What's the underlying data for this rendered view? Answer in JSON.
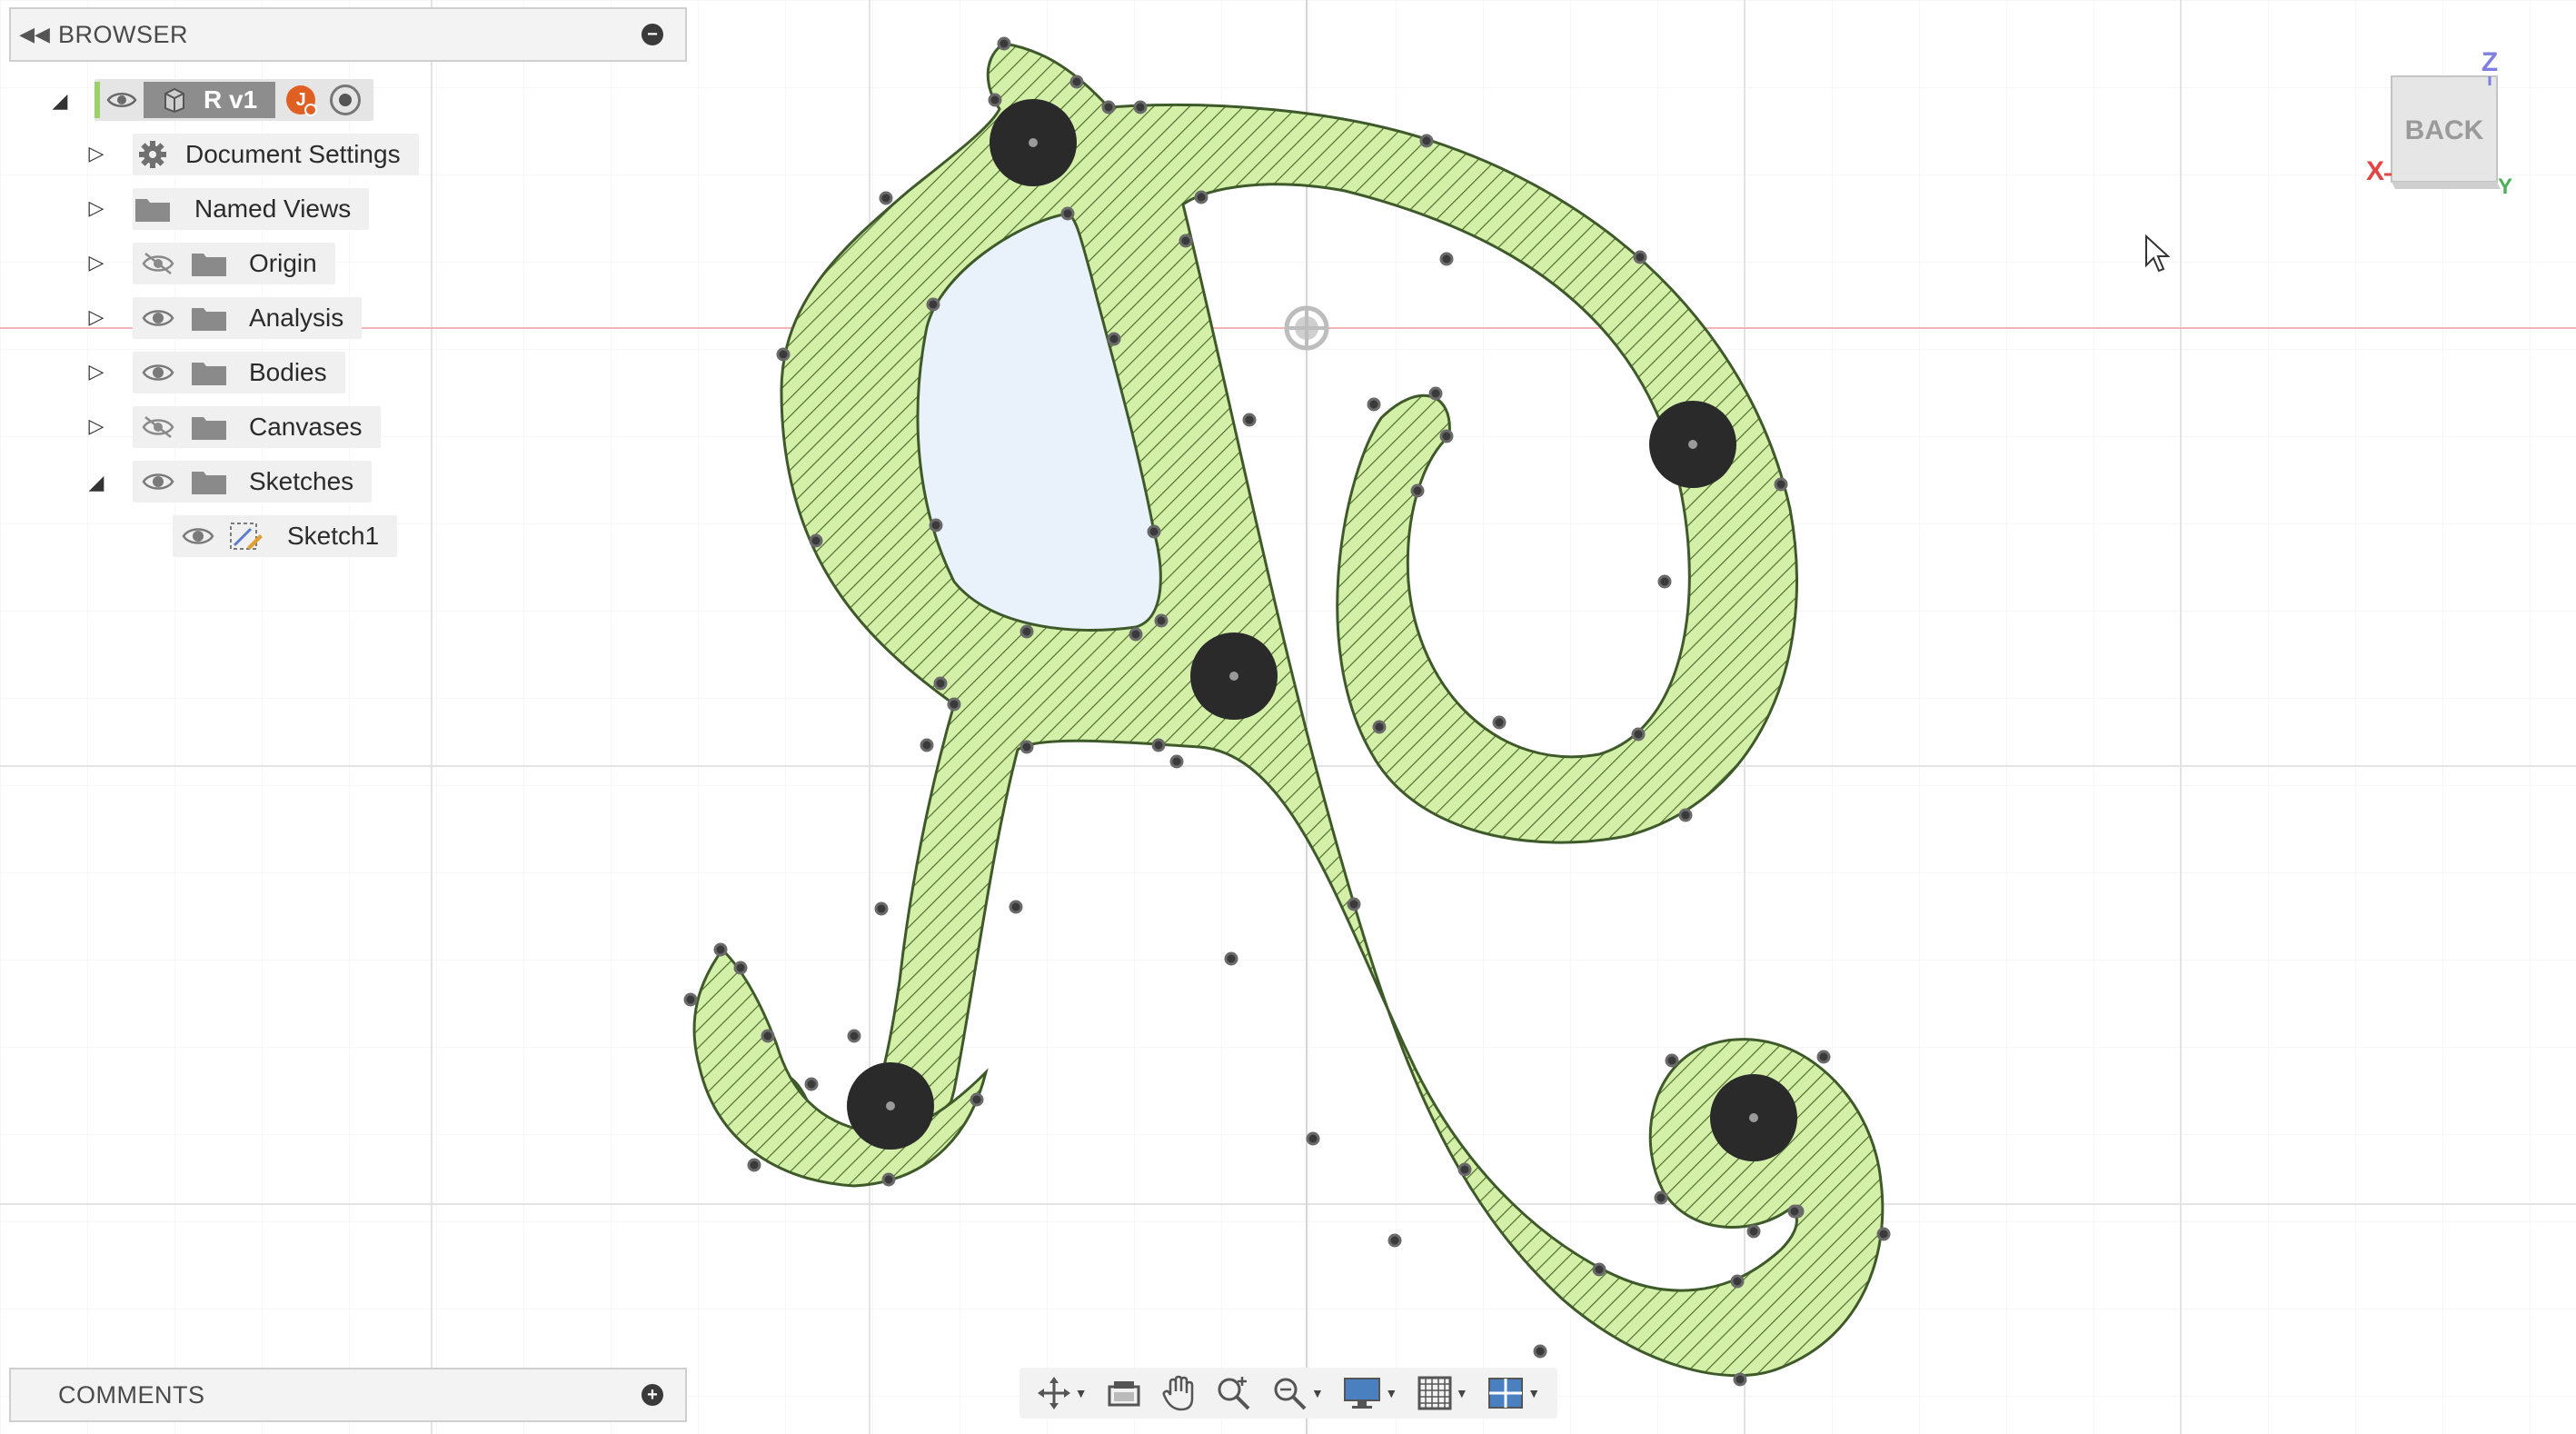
{
  "browser": {
    "title": "BROWSER",
    "collapse_icon": "double-chevron-left-icon",
    "pin_icon": "minus-circle-icon",
    "root": {
      "name": "R v1",
      "user_initial": "J"
    },
    "items": [
      {
        "label": "Document Settings",
        "icon": "gear-icon",
        "eye": "none",
        "expanded": false
      },
      {
        "label": "Named Views",
        "icon": "folder-icon",
        "eye": "none",
        "expanded": false
      },
      {
        "label": "Origin",
        "icon": "folder-icon",
        "eye": "hidden",
        "expanded": false
      },
      {
        "label": "Analysis",
        "icon": "folder-icon",
        "eye": "visible",
        "expanded": false
      },
      {
        "label": "Bodies",
        "icon": "folder-icon",
        "eye": "visible",
        "expanded": false
      },
      {
        "label": "Canvases",
        "icon": "folder-icon",
        "eye": "hidden",
        "expanded": false
      },
      {
        "label": "Sketches",
        "icon": "folder-icon",
        "eye": "visible",
        "expanded": true
      }
    ],
    "sketch_child": {
      "label": "Sketch1",
      "icon": "sketch-icon"
    }
  },
  "comments": {
    "title": "COMMENTS",
    "add_icon": "plus-circle-icon"
  },
  "viewcube": {
    "face_label": "BACK",
    "axis_x": "X",
    "axis_y": "Y",
    "axis_z": "Z"
  },
  "toolbar": {
    "tools": [
      "orbit-icon",
      "look-at-icon",
      "pan-icon",
      "zoom-icon",
      "fit-icon",
      "display-settings-icon",
      "grid-icon",
      "viewports-icon"
    ]
  },
  "colors": {
    "sketch_fill": "#d4efa8",
    "hatch": "#4f6f2f",
    "inner_profile": "#e9f2fb",
    "grid": "#e8e8e8",
    "axis_red": "#f0a0a0",
    "axis_x": "#e34545",
    "axis_y": "#4cb05a",
    "axis_z": "#7f7fe0",
    "user_badge": "#e06024"
  }
}
